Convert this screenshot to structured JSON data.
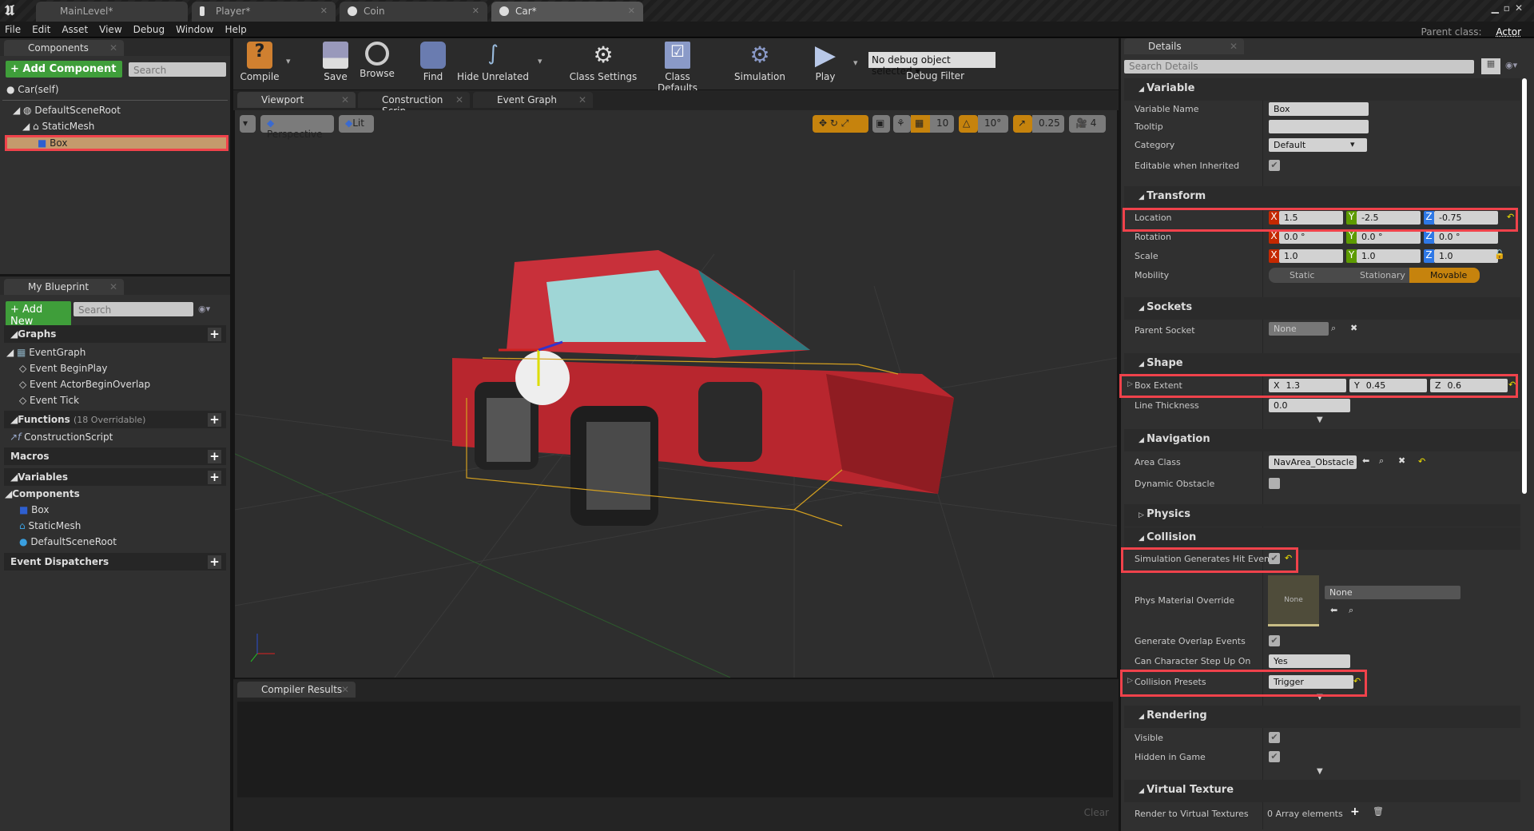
{
  "doc_tabs": [
    {
      "label": "MainLevel*"
    },
    {
      "label": "Player*"
    },
    {
      "label": "Coin"
    },
    {
      "label": "Car*"
    }
  ],
  "menu": [
    "File",
    "Edit",
    "Asset",
    "View",
    "Debug",
    "Window",
    "Help"
  ],
  "parent_class": {
    "label": "Parent class:",
    "value": "Actor"
  },
  "components": {
    "tab": "Components",
    "add_button": "+ Add Component",
    "search_placeholder": "Search",
    "self": "Car(self)",
    "tree": [
      "DefaultSceneRoot",
      "StaticMesh",
      "Box"
    ],
    "selected": "Box"
  },
  "my_blueprint": {
    "tab": "My Blueprint",
    "add_button": "+ Add New",
    "search_placeholder": "Search",
    "graphs": "Graphs",
    "event_graph": "EventGraph",
    "events": [
      "Event BeginPlay",
      "Event ActorBeginOverlap",
      "Event Tick"
    ],
    "functions": "Functions",
    "functions_note": "(18 Overridable)",
    "construction": "ConstructionScript",
    "macros": "Macros",
    "variables": "Variables",
    "components": "Components",
    "component_vars": [
      "Box",
      "StaticMesh",
      "DefaultSceneRoot"
    ],
    "dispatchers": "Event Dispatchers"
  },
  "toolbar": {
    "compile": "Compile",
    "save": "Save",
    "browse": "Browse",
    "find": "Find",
    "hide_unrelated": "Hide Unrelated",
    "class_settings": "Class Settings",
    "class_defaults": "Class Defaults",
    "simulation": "Simulation",
    "play": "Play",
    "debug_select": "No debug object selected",
    "debug_filter": "Debug Filter"
  },
  "editor_tabs": [
    {
      "label": "Viewport"
    },
    {
      "label": "Construction Scrip"
    },
    {
      "label": "Event Graph"
    }
  ],
  "viewport": {
    "perspective": "Perspective",
    "lit": "Lit",
    "grid_snap": "10",
    "rot_snap": "10°",
    "scale_snap": "0.25",
    "camera_speed": "4"
  },
  "compiler": {
    "tab": "Compiler Results",
    "clear": "Clear"
  },
  "details": {
    "tab": "Details",
    "search_placeholder": "Search Details",
    "sections": {
      "variable": "Variable",
      "transform": "Transform",
      "sockets": "Sockets",
      "shape": "Shape",
      "navigation": "Navigation",
      "physics": "Physics",
      "collision": "Collision",
      "rendering": "Rendering",
      "virtual_texture": "Virtual Texture"
    },
    "variable_name": {
      "label": "Variable Name",
      "value": "Box"
    },
    "tooltip": {
      "label": "Tooltip",
      "value": ""
    },
    "category": {
      "label": "Category",
      "value": "Default"
    },
    "editable_inherited": {
      "label": "Editable when Inherited",
      "checked": true
    },
    "location": {
      "label": "Location",
      "x": "1.5",
      "y": "-2.5",
      "z": "-0.75"
    },
    "rotation": {
      "label": "Rotation",
      "x": "0.0 °",
      "y": "0.0 °",
      "z": "0.0 °"
    },
    "scale": {
      "label": "Scale",
      "x": "1.0",
      "y": "1.0",
      "z": "1.0"
    },
    "mobility": {
      "label": "Mobility",
      "options": [
        "Static",
        "Stationary",
        "Movable"
      ],
      "selected": "Movable"
    },
    "parent_socket": {
      "label": "Parent Socket",
      "value": "None"
    },
    "box_extent": {
      "label": "Box Extent",
      "x": "1.3",
      "y": "0.45",
      "z": "0.6"
    },
    "line_thickness": {
      "label": "Line Thickness",
      "value": "0.0"
    },
    "area_class": {
      "label": "Area Class",
      "value": "NavArea_Obstacle"
    },
    "dynamic_obstacle": {
      "label": "Dynamic Obstacle",
      "checked": false
    },
    "sim_hit": {
      "label": "Simulation Generates Hit Event",
      "checked": true
    },
    "phys_material": {
      "label": "Phys Material Override",
      "thumb": "None",
      "value": "None"
    },
    "overlap": {
      "label": "Generate Overlap Events",
      "checked": true
    },
    "step_up": {
      "label": "Can Character Step Up On",
      "value": "Yes"
    },
    "presets": {
      "label": "Collision Presets",
      "value": "Trigger"
    },
    "visible": {
      "label": "Visible",
      "checked": true
    },
    "hidden": {
      "label": "Hidden in Game",
      "checked": true
    },
    "render_vt": {
      "label": "Render to Virtual Textures",
      "value": "0 Array elements"
    },
    "axis_labels": {
      "x": "X",
      "y": "Y",
      "z": "Z"
    }
  },
  "colors": {
    "accent_orange": "#c6830d",
    "highlight_red": "#f0424b",
    "green_button": "#3f9e3a",
    "axis_x": "#c52800",
    "axis_y": "#5d9b00",
    "axis_z": "#2e78e6"
  }
}
